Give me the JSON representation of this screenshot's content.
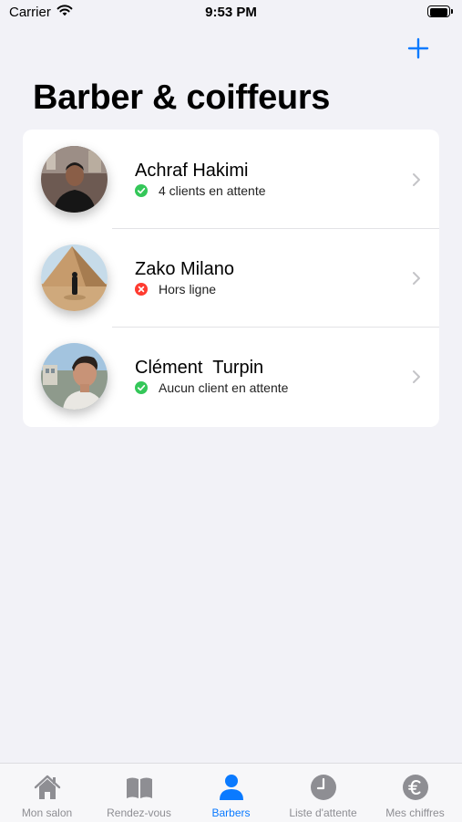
{
  "status_bar": {
    "carrier": "Carrier",
    "time": "9:53 PM"
  },
  "header": {
    "title": "Barber & coiffeurs",
    "add_icon": "plus-icon"
  },
  "barbers": [
    {
      "name": "Achraf Hakimi",
      "status": "4 clients en attente",
      "status_type": "online"
    },
    {
      "name": "Zako Milano",
      "status": "Hors ligne",
      "status_type": "offline"
    },
    {
      "name": "Clément  Turpin",
      "status": "Aucun client en attente",
      "status_type": "online"
    }
  ],
  "tabs": [
    {
      "label": "Mon salon",
      "icon": "house-icon",
      "active": false
    },
    {
      "label": "Rendez-vous",
      "icon": "book-icon",
      "active": false
    },
    {
      "label": "Barbers",
      "icon": "person-icon",
      "active": true
    },
    {
      "label": "Liste d'attente",
      "icon": "clock-icon",
      "active": false
    },
    {
      "label": "Mes chiffres",
      "icon": "euro-icon",
      "active": false
    }
  ],
  "colors": {
    "accent": "#0a7aff",
    "online": "#34c759",
    "offline": "#ff3b30",
    "inactive_tab": "#8e8e93",
    "background": "#f2f2f7"
  }
}
